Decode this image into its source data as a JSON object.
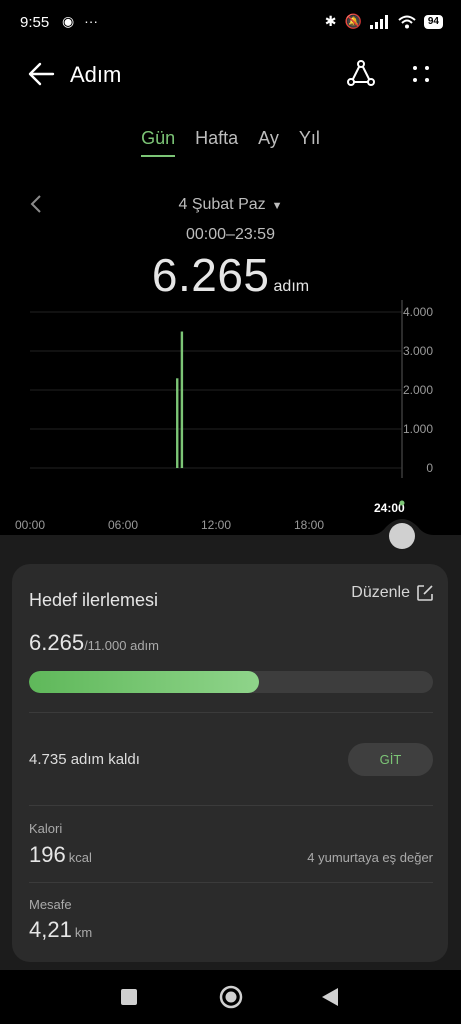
{
  "status": {
    "time": "9:55",
    "battery": "94"
  },
  "header": {
    "title": "Adım"
  },
  "tabs": [
    {
      "label": "Gün",
      "active": true
    },
    {
      "label": "Hafta",
      "active": false
    },
    {
      "label": "Ay",
      "active": false
    },
    {
      "label": "Yıl",
      "active": false
    }
  ],
  "date": {
    "label": "4 Şubat Paz",
    "range": "00:00–23:59"
  },
  "summary": {
    "steps": "6.265",
    "unit": "adım"
  },
  "chart_data": {
    "type": "bar",
    "x_tick_labels": [
      "00:00",
      "06:00",
      "12:00",
      "18:00",
      "24:00"
    ],
    "y_tick_labels": [
      "4.000",
      "3.000",
      "2.000",
      "1.000",
      "0"
    ],
    "ylim": [
      0,
      4000
    ],
    "xlim_hours": [
      0,
      24
    ],
    "bars": [
      {
        "hour": 9.5,
        "value": 2300
      },
      {
        "hour": 9.8,
        "value": 3500
      }
    ],
    "grid": true,
    "bar_color": "#7cc576"
  },
  "goal": {
    "title": "Hedef ilerlemesi",
    "edit_label": "Düzenle",
    "current": "6.265",
    "target": "/11.000 adım",
    "progress": 0.57,
    "remaining": "4.735 adım kaldı",
    "go_label": "GİT"
  },
  "calories": {
    "label": "Kalori",
    "value": "196",
    "unit": "kcal",
    "equivalent": "4 yumurtaya eş değer"
  },
  "distance": {
    "label": "Mesafe",
    "value": "4,21",
    "unit": "km"
  },
  "colors": {
    "accent": "#7cc576",
    "card": "#2b2b2b",
    "background": "#000000"
  }
}
